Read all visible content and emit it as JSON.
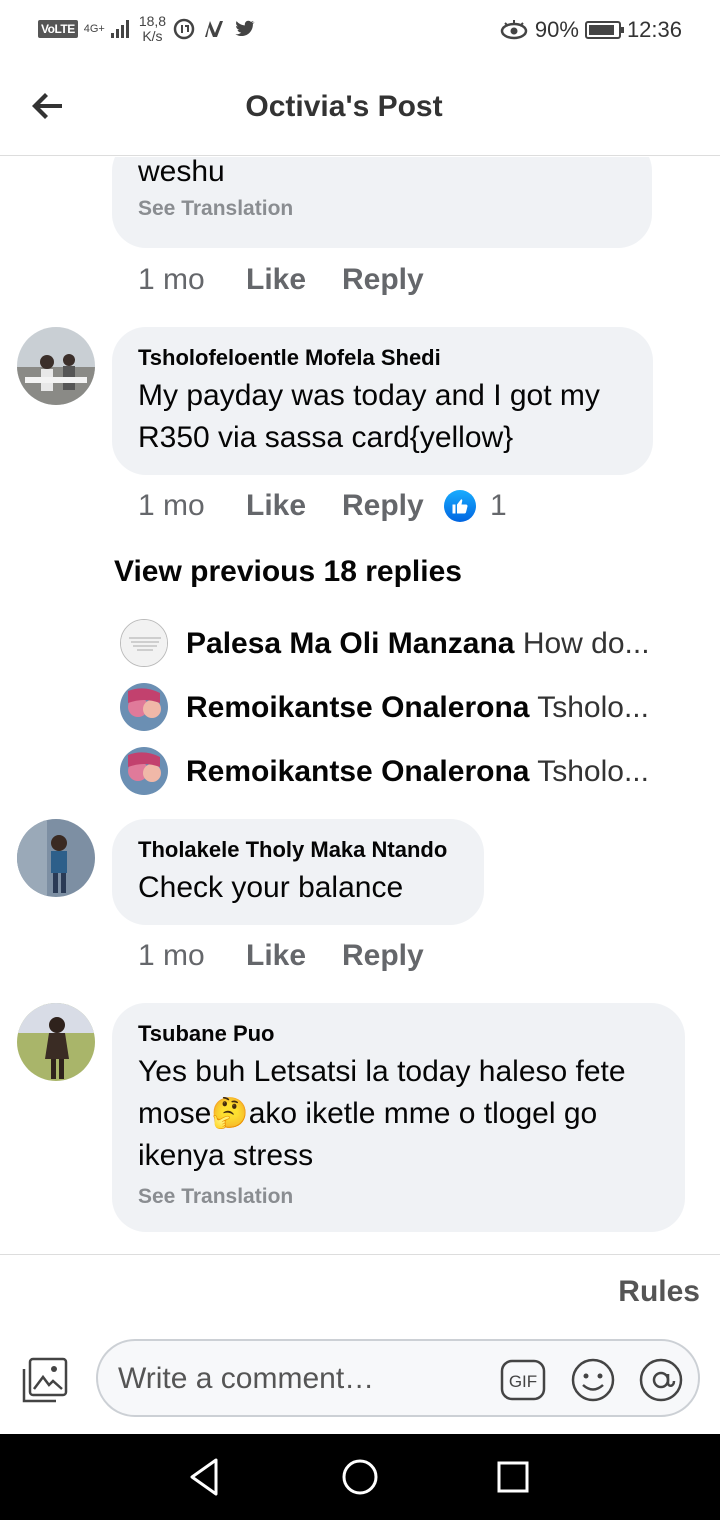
{
  "status_bar": {
    "volte": "VoLTE",
    "network": "4G+",
    "speed_value": "18,8",
    "speed_unit": "K/s",
    "battery": "90%",
    "battery_level": 0.9,
    "time": "12:36"
  },
  "header": {
    "title": "Octivia's Post"
  },
  "comments": [
    {
      "text": "weshu",
      "see_translation": "See Translation",
      "time": "1 mo",
      "like": "Like",
      "reply": "Reply"
    },
    {
      "author": "Tsholofeloentle Mofela Shedi",
      "text": "My payday was today and I got my R350 via sassa card{yellow}",
      "time": "1 mo",
      "like": "Like",
      "reply": "Reply",
      "reaction_count": "1"
    },
    {
      "author": "Tholakele Tholy Maka Ntando",
      "text": "Check your balance",
      "time": "1 mo",
      "like": "Like",
      "reply": "Reply"
    },
    {
      "author": "Tsubane Puo",
      "text": "Yes buh Letsatsi la today haleso fete mose🤔ako iketle mme o tlogel go ikenya stress",
      "see_translation": "See Translation"
    }
  ],
  "view_previous": "View previous 18 replies",
  "replies": [
    {
      "name": "Palesa Ma Oli Manzana",
      "text": "How do..."
    },
    {
      "name": "Remoikantse Onalerona",
      "text": "Tsholo..."
    },
    {
      "name": "Remoikantse Onalerona",
      "text": "Tsholo..."
    }
  ],
  "composer": {
    "rules": "Rules",
    "placeholder": "Write a comment…",
    "gif": "GIF"
  },
  "colors": {
    "bubble": "#f0f2f5",
    "meta_gray": "#65676b",
    "like_blue": "#1877f2"
  }
}
